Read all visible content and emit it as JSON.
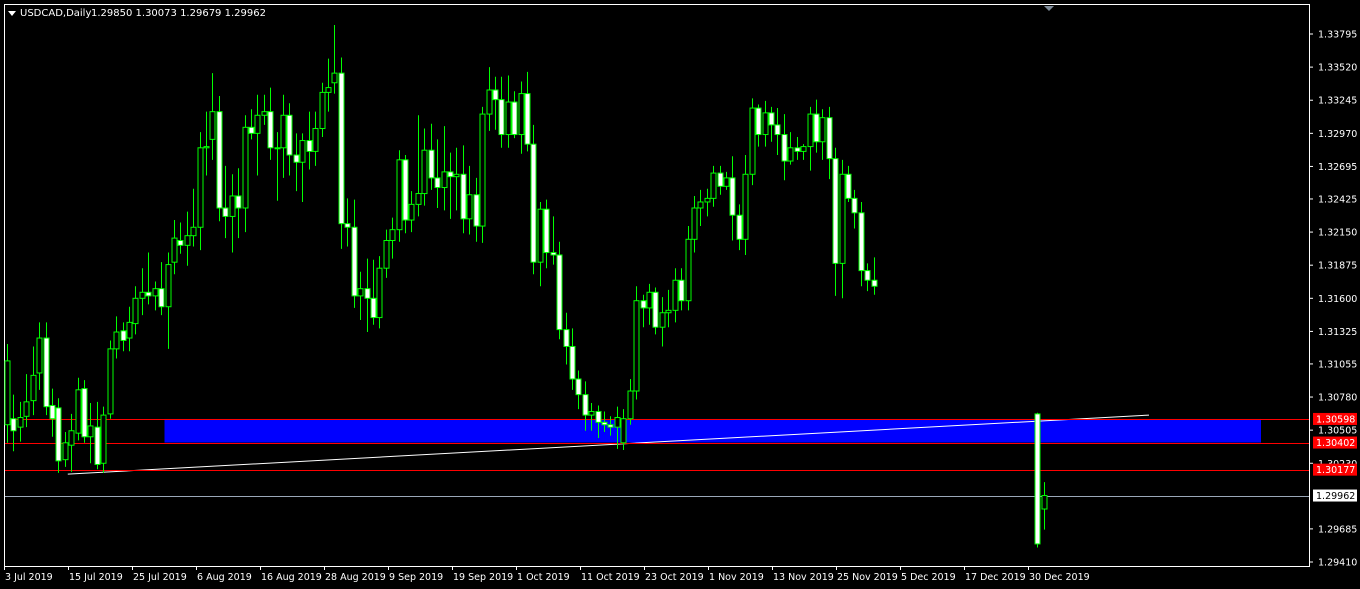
{
  "chart_header": {
    "symbol_period": "USDCAD,Daily",
    "ohlc_values": "1.29850 1.30073 1.29679 1.29962"
  },
  "chart_data": {
    "type": "candlestick",
    "symbol": "USDCAD",
    "period": "Daily",
    "open": 1.2985,
    "high": 1.30073,
    "low": 1.29679,
    "close": 1.29962,
    "y_ticks": [
      "1.33795",
      "1.33520",
      "1.33245",
      "1.32970",
      "1.32695",
      "1.32425",
      "1.32150",
      "1.31875",
      "1.31600",
      "1.31325",
      "1.31055",
      "1.30780",
      "1.30505",
      "1.30230",
      "1.29685",
      "1.29410"
    ],
    "ylim": [
      1.2941,
      1.3403
    ],
    "x_ticks": [
      "3 Jul 2019",
      "15 Jul 2019",
      "25 Jul 2019",
      "6 Aug 2019",
      "16 Aug 2019",
      "28 Aug 2019",
      "9 Sep 2019",
      "19 Sep 2019",
      "1 Oct 2019",
      "11 Oct 2019",
      "23 Oct 2019",
      "1 Nov 2019",
      "13 Nov 2019",
      "25 Nov 2019",
      "5 Dec 2019",
      "17 Dec 2019",
      "30 Dec 2019"
    ],
    "levels": [
      {
        "price": 1.30598,
        "label": "1.30598",
        "color": "#ff0000",
        "label_bg": "#ff0000",
        "label_fg": "#ffffff"
      },
      {
        "price": 1.30402,
        "label": "1.30402",
        "color": "#ff0000",
        "label_bg": "#ff0000",
        "label_fg": "#ffffff"
      },
      {
        "price": 1.30177,
        "label": "1.30177",
        "color": "#ff0000",
        "label_bg": "#ff0000",
        "label_fg": "#ffffff"
      },
      {
        "price": 1.29962,
        "label": "1.29962",
        "color": "#9aa7b8",
        "label_bg": "#ffffff",
        "label_fg": "#000000"
      }
    ],
    "zone": {
      "from_date": "6 Aug 2019",
      "to_date": "right edge",
      "top": 1.30598,
      "bottom": 1.30402,
      "color": "#0000ff"
    },
    "trendline": {
      "from": {
        "date": "15 Jul 2019",
        "price": 1.3014
      },
      "to": {
        "date": "9 Jan 2020",
        "price": 1.3063
      },
      "color": "#ffffff"
    },
    "candles": [
      {
        "d": "2 Jul 2019",
        "o": 1.3055,
        "h": 1.3122,
        "l": 1.304,
        "c": 1.3108
      },
      {
        "d": "3 Jul 2019",
        "o": 1.306,
        "h": 1.308,
        "l": 1.3033,
        "c": 1.305
      },
      {
        "d": "4 Jul 2019",
        "o": 1.3053,
        "h": 1.3074,
        "l": 1.3041,
        "c": 1.3061
      },
      {
        "d": "5 Jul 2019",
        "o": 1.3062,
        "h": 1.3097,
        "l": 1.3053,
        "c": 1.3074
      },
      {
        "d": "8 Jul 2019",
        "o": 1.3075,
        "h": 1.312,
        "l": 1.3063,
        "c": 1.3096
      },
      {
        "d": "9 Jul 2019",
        "o": 1.3098,
        "h": 1.314,
        "l": 1.3084,
        "c": 1.3127
      },
      {
        "d": "10 Jul 2019",
        "o": 1.3127,
        "h": 1.314,
        "l": 1.3063,
        "c": 1.307
      },
      {
        "d": "11 Jul 2019",
        "o": 1.3071,
        "h": 1.3085,
        "l": 1.3045,
        "c": 1.306
      },
      {
        "d": "12 Jul 2019",
        "o": 1.3069,
        "h": 1.3077,
        "l": 1.3015,
        "c": 1.3025
      },
      {
        "d": "15 Jul 2019",
        "o": 1.3026,
        "h": 1.3049,
        "l": 1.302,
        "c": 1.304
      },
      {
        "d": "16 Jul 2019",
        "o": 1.3038,
        "h": 1.3064,
        "l": 1.3016,
        "c": 1.305
      },
      {
        "d": "17 Jul 2019",
        "o": 1.3048,
        "h": 1.3094,
        "l": 1.3042,
        "c": 1.3084
      },
      {
        "d": "18 Jul 2019",
        "o": 1.3085,
        "h": 1.3092,
        "l": 1.304,
        "c": 1.3045
      },
      {
        "d": "19 Jul 2019",
        "o": 1.3045,
        "h": 1.3073,
        "l": 1.3023,
        "c": 1.3054
      },
      {
        "d": "22 Jul 2019",
        "o": 1.3053,
        "h": 1.3074,
        "l": 1.3018,
        "c": 1.3022
      },
      {
        "d": "23 Jul 2019",
        "o": 1.3023,
        "h": 1.307,
        "l": 1.3015,
        "c": 1.3063
      },
      {
        "d": "24 Jul 2019",
        "o": 1.3064,
        "h": 1.3125,
        "l": 1.306,
        "c": 1.3118
      },
      {
        "d": "25 Jul 2019",
        "o": 1.3118,
        "h": 1.3145,
        "l": 1.311,
        "c": 1.3132
      },
      {
        "d": "26 Jul 2019",
        "o": 1.3133,
        "h": 1.314,
        "l": 1.3116,
        "c": 1.3125
      },
      {
        "d": "29 Jul 2019",
        "o": 1.3127,
        "h": 1.3153,
        "l": 1.3116,
        "c": 1.314
      },
      {
        "d": "30 Jul 2019",
        "o": 1.3139,
        "h": 1.317,
        "l": 1.313,
        "c": 1.316
      },
      {
        "d": "31 Jul 2019",
        "o": 1.316,
        "h": 1.3185,
        "l": 1.3146,
        "c": 1.3165
      },
      {
        "d": "1 Aug 2019",
        "o": 1.3165,
        "h": 1.3198,
        "l": 1.3155,
        "c": 1.3162
      },
      {
        "d": "2 Aug 2019",
        "o": 1.3162,
        "h": 1.3174,
        "l": 1.315,
        "c": 1.3168
      },
      {
        "d": "5 Aug 2019",
        "o": 1.3168,
        "h": 1.319,
        "l": 1.3146,
        "c": 1.3153
      },
      {
        "d": "6 Aug 2019",
        "o": 1.3153,
        "h": 1.3198,
        "l": 1.3118,
        "c": 1.3188
      },
      {
        "d": "7 Aug 2019",
        "o": 1.319,
        "h": 1.3225,
        "l": 1.318,
        "c": 1.321
      },
      {
        "d": "8 Aug 2019",
        "o": 1.3208,
        "h": 1.3223,
        "l": 1.3197,
        "c": 1.3204
      },
      {
        "d": "9 Aug 2019",
        "o": 1.3204,
        "h": 1.3232,
        "l": 1.3187,
        "c": 1.3212
      },
      {
        "d": "12 Aug 2019",
        "o": 1.3212,
        "h": 1.3251,
        "l": 1.3203,
        "c": 1.3219
      },
      {
        "d": "13 Aug 2019",
        "o": 1.3219,
        "h": 1.3298,
        "l": 1.32,
        "c": 1.3285
      },
      {
        "d": "14 Aug 2019",
        "o": 1.3285,
        "h": 1.3315,
        "l": 1.3262,
        "c": 1.3286
      },
      {
        "d": "15 Aug 2019",
        "o": 1.3292,
        "h": 1.3347,
        "l": 1.3275,
        "c": 1.3315
      },
      {
        "d": "16 Aug 2019",
        "o": 1.3315,
        "h": 1.3328,
        "l": 1.3224,
        "c": 1.3235
      },
      {
        "d": "19 Aug 2019",
        "o": 1.3235,
        "h": 1.327,
        "l": 1.321,
        "c": 1.3228
      },
      {
        "d": "20 Aug 2019",
        "o": 1.3228,
        "h": 1.3263,
        "l": 1.3198,
        "c": 1.3245
      },
      {
        "d": "21 Aug 2019",
        "o": 1.3245,
        "h": 1.3268,
        "l": 1.321,
        "c": 1.3235
      },
      {
        "d": "22 Aug 2019",
        "o": 1.3235,
        "h": 1.3312,
        "l": 1.3215,
        "c": 1.3302
      },
      {
        "d": "23 Aug 2019",
        "o": 1.3302,
        "h": 1.3317,
        "l": 1.3292,
        "c": 1.3297
      },
      {
        "d": "26 Aug 2019",
        "o": 1.3297,
        "h": 1.3329,
        "l": 1.3262,
        "c": 1.3312
      },
      {
        "d": "27 Aug 2019",
        "o": 1.3312,
        "h": 1.3329,
        "l": 1.3304,
        "c": 1.3315
      },
      {
        "d": "28 Aug 2019",
        "o": 1.3315,
        "h": 1.3335,
        "l": 1.3275,
        "c": 1.3285
      },
      {
        "d": "29 Aug 2019",
        "o": 1.3285,
        "h": 1.3298,
        "l": 1.3241,
        "c": 1.3285
      },
      {
        "d": "30 Aug 2019",
        "o": 1.3285,
        "h": 1.3329,
        "l": 1.326,
        "c": 1.3312
      },
      {
        "d": "2 Sep 2019",
        "o": 1.3312,
        "h": 1.3322,
        "l": 1.3262,
        "c": 1.3279
      },
      {
        "d": "3 Sep 2019",
        "o": 1.3279,
        "h": 1.3297,
        "l": 1.3249,
        "c": 1.3273
      },
      {
        "d": "4 Sep 2019",
        "o": 1.3273,
        "h": 1.3297,
        "l": 1.324,
        "c": 1.3291
      },
      {
        "d": "5 Sep 2019",
        "o": 1.3291,
        "h": 1.3315,
        "l": 1.3267,
        "c": 1.3282
      },
      {
        "d": "6 Sep 2019",
        "o": 1.3282,
        "h": 1.3315,
        "l": 1.327,
        "c": 1.3301
      },
      {
        "d": "9 Sep 2019",
        "o": 1.3301,
        "h": 1.3339,
        "l": 1.3294,
        "c": 1.3331
      },
      {
        "d": "10 Sep 2019",
        "o": 1.3331,
        "h": 1.3359,
        "l": 1.3315,
        "c": 1.3335
      },
      {
        "d": "11 Sep 2019",
        "o": 1.3339,
        "h": 1.3387,
        "l": 1.333,
        "c": 1.3347
      },
      {
        "d": "12 Sep 2019",
        "o": 1.3347,
        "h": 1.336,
        "l": 1.3201,
        "c": 1.3222
      },
      {
        "d": "13 Sep 2019",
        "o": 1.3222,
        "h": 1.3243,
        "l": 1.3203,
        "c": 1.3219
      },
      {
        "d": "16 Sep 2019",
        "o": 1.3219,
        "h": 1.3242,
        "l": 1.3152,
        "c": 1.3162
      },
      {
        "d": "17 Sep 2019",
        "o": 1.3162,
        "h": 1.3182,
        "l": 1.3142,
        "c": 1.3168
      },
      {
        "d": "18 Sep 2019",
        "o": 1.3168,
        "h": 1.3193,
        "l": 1.3132,
        "c": 1.316
      },
      {
        "d": "19 Sep 2019",
        "o": 1.316,
        "h": 1.3192,
        "l": 1.3138,
        "c": 1.3144
      },
      {
        "d": "20 Sep 2019",
        "o": 1.3144,
        "h": 1.3195,
        "l": 1.3135,
        "c": 1.3185
      },
      {
        "d": "23 Sep 2019",
        "o": 1.3185,
        "h": 1.3217,
        "l": 1.3177,
        "c": 1.3208
      },
      {
        "d": "24 Sep 2019",
        "o": 1.3208,
        "h": 1.3227,
        "l": 1.3193,
        "c": 1.3217
      },
      {
        "d": "25 Sep 2019",
        "o": 1.3217,
        "h": 1.3283,
        "l": 1.3207,
        "c": 1.3275
      },
      {
        "d": "26 Sep 2019",
        "o": 1.3275,
        "h": 1.3279,
        "l": 1.3214,
        "c": 1.3225
      },
      {
        "d": "27 Sep 2019",
        "o": 1.3225,
        "h": 1.3249,
        "l": 1.3215,
        "c": 1.3238
      },
      {
        "d": "30 Sep 2019",
        "o": 1.3238,
        "h": 1.3312,
        "l": 1.3228,
        "c": 1.3247
      },
      {
        "d": "1 Oct 2019",
        "o": 1.3247,
        "h": 1.3301,
        "l": 1.3237,
        "c": 1.3283
      },
      {
        "d": "2 Oct 2019",
        "o": 1.3283,
        "h": 1.3305,
        "l": 1.325,
        "c": 1.326
      },
      {
        "d": "3 Oct 2019",
        "o": 1.326,
        "h": 1.3292,
        "l": 1.3235,
        "c": 1.3252
      },
      {
        "d": "4 Oct 2019",
        "o": 1.3252,
        "h": 1.3303,
        "l": 1.3233,
        "c": 1.3265
      },
      {
        "d": "7 Oct 2019",
        "o": 1.3265,
        "h": 1.3281,
        "l": 1.3226,
        "c": 1.3261
      },
      {
        "d": "8 Oct 2019",
        "o": 1.3261,
        "h": 1.3285,
        "l": 1.3233,
        "c": 1.3263
      },
      {
        "d": "9 Oct 2019",
        "o": 1.3263,
        "h": 1.3287,
        "l": 1.3214,
        "c": 1.3226
      },
      {
        "d": "10 Oct 2019",
        "o": 1.3226,
        "h": 1.327,
        "l": 1.3213,
        "c": 1.3246
      },
      {
        "d": "11 Oct 2019",
        "o": 1.3246,
        "h": 1.326,
        "l": 1.3207,
        "c": 1.322
      },
      {
        "d": "14 Oct 2019",
        "o": 1.322,
        "h": 1.3319,
        "l": 1.3206,
        "c": 1.3313
      },
      {
        "d": "15 Oct 2019",
        "o": 1.3313,
        "h": 1.3352,
        "l": 1.3299,
        "c": 1.3333
      },
      {
        "d": "16 Oct 2019",
        "o": 1.3333,
        "h": 1.3344,
        "l": 1.33,
        "c": 1.3325
      },
      {
        "d": "17 Oct 2019",
        "o": 1.3325,
        "h": 1.3344,
        "l": 1.3285,
        "c": 1.3296
      },
      {
        "d": "18 Oct 2019",
        "o": 1.3296,
        "h": 1.3345,
        "l": 1.3285,
        "c": 1.3323
      },
      {
        "d": "21 Oct 2019",
        "o": 1.3323,
        "h": 1.3332,
        "l": 1.3293,
        "c": 1.3296
      },
      {
        "d": "22 Oct 2019",
        "o": 1.3296,
        "h": 1.334,
        "l": 1.328,
        "c": 1.333
      },
      {
        "d": "23 Oct 2019",
        "o": 1.333,
        "h": 1.3348,
        "l": 1.3282,
        "c": 1.3288
      },
      {
        "d": "24 Oct 2019",
        "o": 1.3288,
        "h": 1.3304,
        "l": 1.318,
        "c": 1.319
      },
      {
        "d": "25 Oct 2019",
        "o": 1.319,
        "h": 1.324,
        "l": 1.317,
        "c": 1.3234
      },
      {
        "d": "28 Oct 2019",
        "o": 1.3234,
        "h": 1.3242,
        "l": 1.3185,
        "c": 1.3198
      },
      {
        "d": "29 Oct 2019",
        "o": 1.3198,
        "h": 1.3228,
        "l": 1.3188,
        "c": 1.3196
      },
      {
        "d": "30 Oct 2019",
        "o": 1.3196,
        "h": 1.3207,
        "l": 1.3126,
        "c": 1.3134
      },
      {
        "d": "31 Oct 2019",
        "o": 1.3134,
        "h": 1.3148,
        "l": 1.3105,
        "c": 1.312
      },
      {
        "d": "1 Nov 2019",
        "o": 1.312,
        "h": 1.3135,
        "l": 1.3084,
        "c": 1.3093
      },
      {
        "d": "4 Nov 2019",
        "o": 1.3093,
        "h": 1.31,
        "l": 1.3068,
        "c": 1.308
      },
      {
        "d": "5 Nov 2019",
        "o": 1.308,
        "h": 1.3091,
        "l": 1.305,
        "c": 1.3063
      },
      {
        "d": "6 Nov 2019",
        "o": 1.3063,
        "h": 1.3073,
        "l": 1.305,
        "c": 1.3066
      },
      {
        "d": "7 Nov 2019",
        "o": 1.3066,
        "h": 1.3071,
        "l": 1.3044,
        "c": 1.3057
      },
      {
        "d": "8 Nov 2019",
        "o": 1.3057,
        "h": 1.3066,
        "l": 1.3049,
        "c": 1.3055
      },
      {
        "d": "11 Nov 2019",
        "o": 1.3055,
        "h": 1.3062,
        "l": 1.3046,
        "c": 1.3053
      },
      {
        "d": "12 Nov 2019",
        "o": 1.3053,
        "h": 1.307,
        "l": 1.3035,
        "c": 1.3061
      },
      {
        "d": "13 Nov 2019",
        "o": 1.304,
        "h": 1.3068,
        "l": 1.3034,
        "c": 1.306
      },
      {
        "d": "14 Nov 2019",
        "o": 1.306,
        "h": 1.3093,
        "l": 1.3055,
        "c": 1.3083
      },
      {
        "d": "15 Nov 2019",
        "o": 1.3083,
        "h": 1.317,
        "l": 1.3076,
        "c": 1.3158
      },
      {
        "d": "18 Nov 2019",
        "o": 1.3158,
        "h": 1.3163,
        "l": 1.3136,
        "c": 1.3152
      },
      {
        "d": "19 Nov 2019",
        "o": 1.3152,
        "h": 1.3172,
        "l": 1.3138,
        "c": 1.3165
      },
      {
        "d": "20 Nov 2019",
        "o": 1.3165,
        "h": 1.3169,
        "l": 1.313,
        "c": 1.3136
      },
      {
        "d": "21 Nov 2019",
        "o": 1.3136,
        "h": 1.3161,
        "l": 1.312,
        "c": 1.3148
      },
      {
        "d": "22 Nov 2019",
        "o": 1.3148,
        "h": 1.3167,
        "l": 1.3136,
        "c": 1.315
      },
      {
        "d": "25 Nov 2019",
        "o": 1.315,
        "h": 1.3185,
        "l": 1.314,
        "c": 1.3175
      },
      {
        "d": "26 Nov 2019",
        "o": 1.3175,
        "h": 1.3185,
        "l": 1.315,
        "c": 1.3158
      },
      {
        "d": "27 Nov 2019",
        "o": 1.3158,
        "h": 1.322,
        "l": 1.315,
        "c": 1.3209
      },
      {
        "d": "28 Nov 2019",
        "o": 1.3209,
        "h": 1.3245,
        "l": 1.3198,
        "c": 1.3235
      },
      {
        "d": "29 Nov 2019",
        "o": 1.3235,
        "h": 1.325,
        "l": 1.322,
        "c": 1.324
      },
      {
        "d": "2 Dec 2019",
        "o": 1.324,
        "h": 1.3251,
        "l": 1.3228,
        "c": 1.3243
      },
      {
        "d": "3 Dec 2019",
        "o": 1.3243,
        "h": 1.327,
        "l": 1.3236,
        "c": 1.3264
      },
      {
        "d": "4 Dec 2019",
        "o": 1.3264,
        "h": 1.327,
        "l": 1.3246,
        "c": 1.3253
      },
      {
        "d": "5 Dec 2019",
        "o": 1.3253,
        "h": 1.3265,
        "l": 1.325,
        "c": 1.326
      },
      {
        "d": "6 Dec 2019",
        "o": 1.326,
        "h": 1.3278,
        "l": 1.3208,
        "c": 1.3229
      },
      {
        "d": "9 Dec 2019",
        "o": 1.3229,
        "h": 1.3238,
        "l": 1.32,
        "c": 1.3209
      },
      {
        "d": "10 Dec 2019",
        "o": 1.3209,
        "h": 1.3279,
        "l": 1.3196,
        "c": 1.3263
      },
      {
        "d": "11 Dec 2019",
        "o": 1.3263,
        "h": 1.3326,
        "l": 1.3254,
        "c": 1.3318
      },
      {
        "d": "12 Dec 2019",
        "o": 1.3318,
        "h": 1.3321,
        "l": 1.3286,
        "c": 1.3296
      },
      {
        "d": "13 Dec 2019",
        "o": 1.3296,
        "h": 1.3324,
        "l": 1.3286,
        "c": 1.3314
      },
      {
        "d": "16 Dec 2019",
        "o": 1.3314,
        "h": 1.3319,
        "l": 1.329,
        "c": 1.3304
      },
      {
        "d": "17 Dec 2019",
        "o": 1.3304,
        "h": 1.3318,
        "l": 1.3279,
        "c": 1.3296
      },
      {
        "d": "18 Dec 2019",
        "o": 1.3296,
        "h": 1.3313,
        "l": 1.3258,
        "c": 1.3274
      },
      {
        "d": "19 Dec 2019",
        "o": 1.3274,
        "h": 1.3298,
        "l": 1.3271,
        "c": 1.3285
      },
      {
        "d": "20 Dec 2019",
        "o": 1.3285,
        "h": 1.3294,
        "l": 1.3275,
        "c": 1.3282
      },
      {
        "d": "23 Dec 2019",
        "o": 1.3282,
        "h": 1.3288,
        "l": 1.3275,
        "c": 1.3286
      },
      {
        "d": "24 Dec 2019",
        "o": 1.3286,
        "h": 1.3319,
        "l": 1.3266,
        "c": 1.3313
      },
      {
        "d": "25 Dec 2019",
        "o": 1.3313,
        "h": 1.3325,
        "l": 1.3281,
        "c": 1.329
      },
      {
        "d": "26 Dec 2019",
        "o": 1.329,
        "h": 1.3317,
        "l": 1.3275,
        "c": 1.331
      },
      {
        "d": "27 Dec 2019",
        "o": 1.331,
        "h": 1.3319,
        "l": 1.3259,
        "c": 1.3276
      },
      {
        "d": "30 Dec 2019",
        "o": 1.3276,
        "h": 1.3285,
        "l": 1.3162,
        "c": 1.3189
      },
      {
        "d": "31 Dec 2019",
        "o": 1.3189,
        "h": 1.3275,
        "l": 1.316,
        "c": 1.3263
      },
      {
        "d": "1 Jan 2020",
        "o": 1.3263,
        "h": 1.327,
        "l": 1.324,
        "c": 1.3243
      },
      {
        "d": "2 Jan 2020",
        "o": 1.3243,
        "h": 1.325,
        "l": 1.3218,
        "c": 1.3231
      },
      {
        "d": "3 Jan 2020",
        "o": 1.3231,
        "h": 1.324,
        "l": 1.317,
        "c": 1.3183
      },
      {
        "d": "6 Jan 2020",
        "o": 1.3183,
        "h": 1.3189,
        "l": 1.3166,
        "c": 1.3175
      },
      {
        "d": "7 Jan 2020",
        "o": 1.3175,
        "h": 1.3194,
        "l": 1.3163,
        "c": 1.317
      }
    ]
  }
}
